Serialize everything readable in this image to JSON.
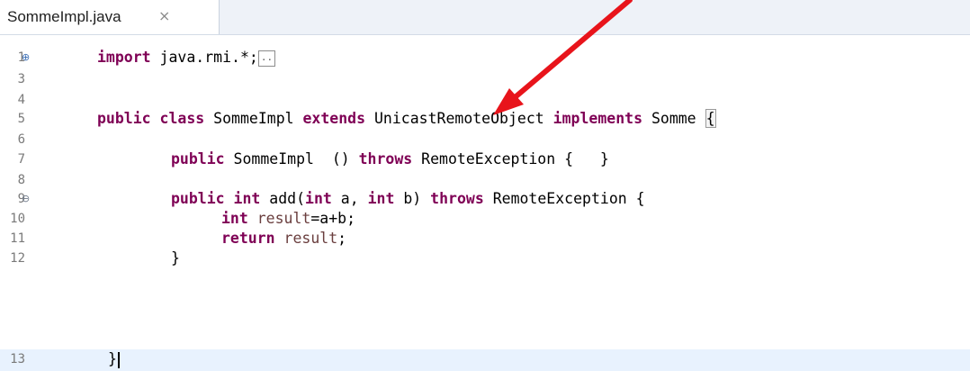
{
  "tab": {
    "title": "SommeImpl.java",
    "close_glyph": "⨯"
  },
  "gutter": {
    "line_numbers": [
      "1",
      "3",
      "4",
      "5",
      "6",
      "7",
      "8",
      "9",
      "10",
      "11",
      "12",
      "13"
    ],
    "fold_expand_glyph": "⊕",
    "fold_collapse_glyph": "⊖"
  },
  "code": {
    "l1_kw": "import",
    "l1_text": " java.rmi.*;",
    "l1_collapsed": "..",
    "l5_kw1": "public",
    "l5_kw2": "class",
    "l5_name": " SommeImpl ",
    "l5_kw3": "extends",
    "l5_super": " UnicastRemoteObject ",
    "l5_kw4": "implements",
    "l5_iface": " Somme ",
    "l5_brace": "{",
    "l7_kw1": "public",
    "l7_text": " SommeImpl  () ",
    "l7_kw2": "throws",
    "l7_rest": " RemoteException {   }",
    "l9_kw1": "public",
    "l9_kw2": "int",
    "l9_m1": " add(",
    "l9_kw3": "int",
    "l9_p1": " a, ",
    "l9_kw4": "int",
    "l9_p2": " b) ",
    "l9_kw5": "throws",
    "l9_rest": " RemoteException {",
    "l10_kw": "int",
    "l10_var": " result",
    "l10_rest": "=a+b;",
    "l11_kw": "return",
    "l11_var": " result",
    "l11_rest": ";",
    "l12_text": "}",
    "l13_text": "}"
  },
  "colors": {
    "keyword": "#7f0055",
    "annotation_arrow": "#e8141b",
    "current_line": "#e8f2fe"
  },
  "annotation": {
    "type": "red-arrow",
    "points_to": "extends"
  }
}
